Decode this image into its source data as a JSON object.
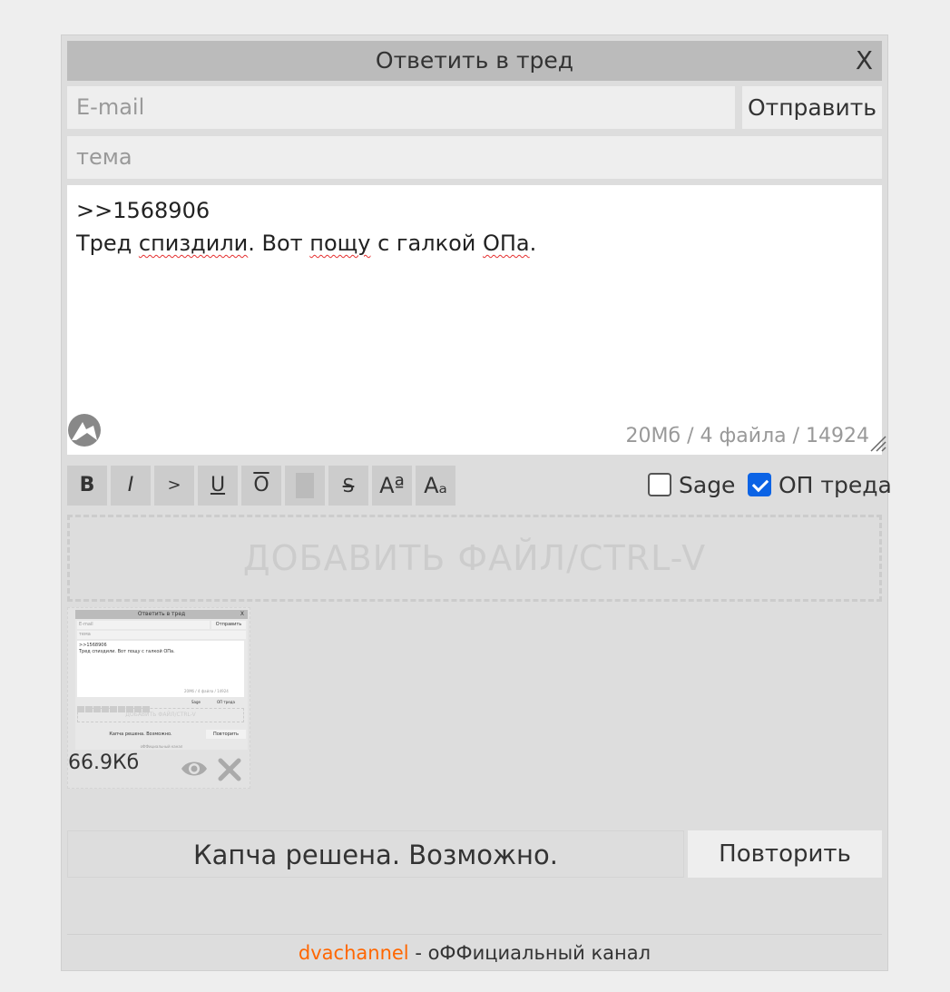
{
  "form": {
    "title": "Ответить в тред",
    "close_label": "X",
    "email_placeholder": "E-mail",
    "send_label": "Отправить",
    "subject_placeholder": "тема",
    "message": {
      "line1": ">>1568906",
      "line2_parts": [
        "Тред ",
        "спиздили",
        ". Вот ",
        "пощу",
        " с галкой ",
        "ОПа",
        "."
      ]
    },
    "counter": "20Мб / 4 файла / 14924"
  },
  "toolbar": {
    "buttons": [
      {
        "label": "B",
        "name": "bold-button"
      },
      {
        "label": "I",
        "name": "italic-button"
      },
      {
        "label": ">",
        "name": "quote-button"
      },
      {
        "label": "U",
        "name": "underline-button"
      },
      {
        "label": "O",
        "name": "overline-button"
      },
      {
        "label": "",
        "name": "spoiler-button"
      },
      {
        "label": "S",
        "name": "strike-button"
      },
      {
        "label": "Aª",
        "name": "superscript-button"
      },
      {
        "label": "Aₐ",
        "name": "subscript-button"
      }
    ],
    "sage_label": "Sage",
    "sage_checked": false,
    "op_label": "ОП треда",
    "op_checked": true
  },
  "dropzone_label": "ДОБАВИТЬ ФАЙЛ/CTRL-V",
  "attachment": {
    "size": "66.9Кб",
    "thumbnail": {
      "title": "Ответить в тред",
      "close": "X",
      "email": "E-mail",
      "send": "Отправить",
      "subject": "тема",
      "line1": ">>1568906",
      "line2": "Тред спиздили. Вот пощу с галкой ОПа.",
      "counter": "20Мб / 4 файла / 14924",
      "sage": "Sage",
      "op": "ОП треда",
      "dropzone": "ДОБАВИТЬ ФАЙЛ/CTRL-V",
      "captcha": "Капча решена. Возможно.",
      "retry": "Повторить",
      "footer": "оФФициальный канал"
    }
  },
  "captcha": {
    "status": "Капча решена. Возможно.",
    "retry_label": "Повторить"
  },
  "footer": {
    "link": "dvachannel",
    "text": " - оФФициальный канал"
  },
  "colors": {
    "footer_link": "#ff6600",
    "checkbox_checked": "#0b63e5",
    "spellcheck": "#e53030"
  },
  "icons": [
    "logo-icon",
    "resize-icon",
    "eye-icon",
    "remove-icon"
  ]
}
